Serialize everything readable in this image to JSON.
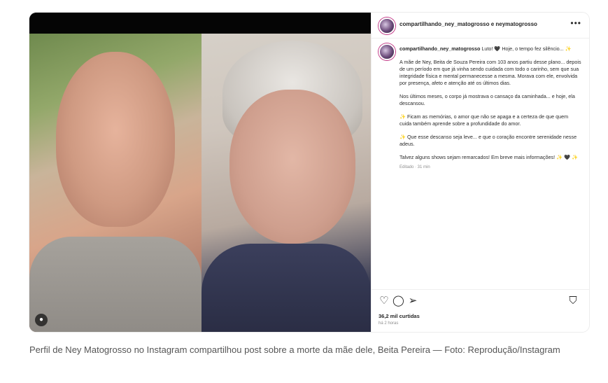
{
  "post": {
    "header": {
      "user_line": "compartilhando_ney_matogrosso e neymatogrosso",
      "more_icon": "•••"
    },
    "media": {
      "tag_icon": "person-tag-icon",
      "tag_glyph": "●"
    },
    "caption": {
      "username": "compartilhando_ney_matogrosso",
      "first_line": " Luto! 🖤 Hoje, o tempo fez silêncio... ✨",
      "paragraphs": [
        "A mãe de Ney, Beita de Souza Pereira com 103 anos partiu desse plano... depois de um período em que já vinha sendo cuidada com todo o carinho, sem que sua integridade física e mental permanecesse a mesma. Morava com ele, envolvida por presença, afeto e atenção até os últimos dias.",
        "Nos últimos meses, o corpo já mostrava o cansaço da caminhada... e hoje, ela descansou.",
        "✨ Ficam as memórias, o amor que não se apaga e a certeza de que quem cuida também aprende sobre a profundidade do amor.",
        "✨ Que esse descanso seja leve... e que o coração encontre serenidade nesse adeus.",
        "Talvez alguns shows sejam remarcados! Em breve mais informações! ✨ 🖤 ✨"
      ],
      "edited": "Editado · 31 min"
    },
    "actions": {
      "like_glyph": "♡",
      "comment_glyph": "◯",
      "share_glyph": "➢",
      "save_glyph": "⛉",
      "likes": "36,2 mil curtidas",
      "time": "há 2 horas"
    }
  },
  "footer": {
    "caption": "Perfil de Ney Matogrosso no Instagram compartilhou post sobre a morte da mãe dele, Beita Pereira — Foto: Reprodução/Instagram"
  },
  "colors": {
    "text_primary": "#262626",
    "text_secondary": "#8e8e8e",
    "caption_gray": "#555555",
    "avatar_ring": "#c13584"
  }
}
